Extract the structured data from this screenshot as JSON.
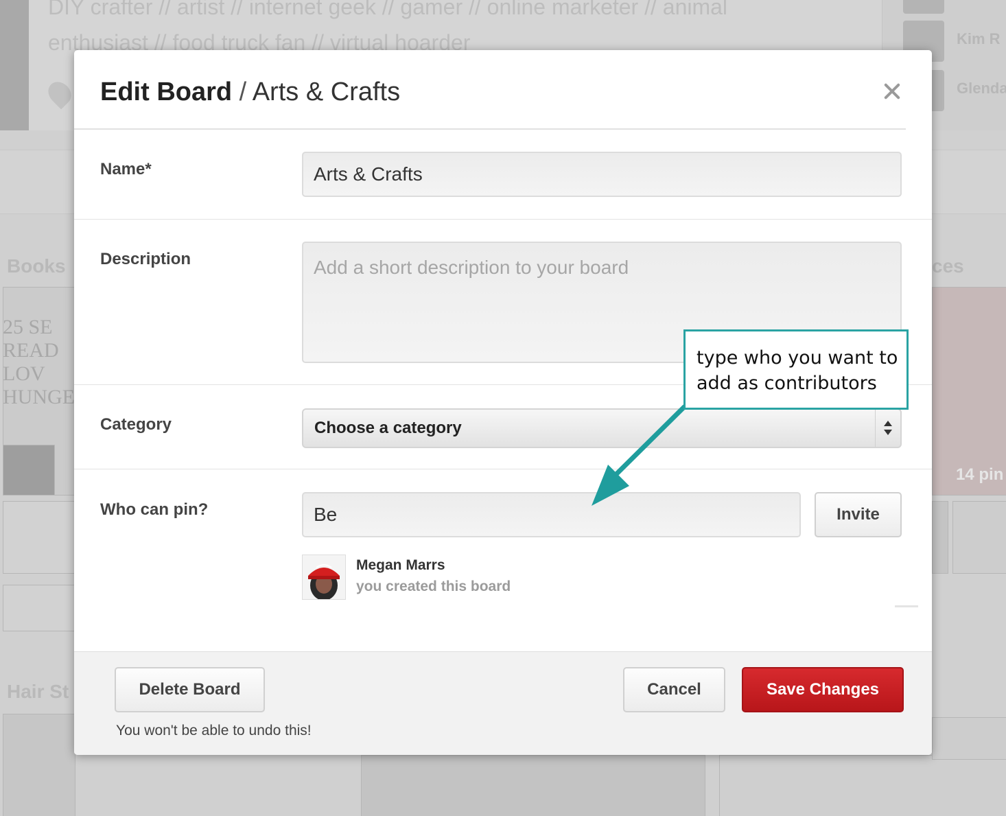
{
  "background": {
    "bio_line1": "DIY crafter // artist // internet geek // gamer // online marketer // animal",
    "bio_line2": "enthusiast // food truck fan // virtual hoarder",
    "sidebar_names": [
      "Kim R",
      "Glenda"
    ],
    "board_titles": [
      "Books",
      "ces",
      "Hair St"
    ],
    "book_cover_text": "25 SE READ LOV HUNGE",
    "pins_count": "14 pin"
  },
  "modal": {
    "title_action": "Edit Board",
    "title_separator": " / ",
    "title_board": "Arts & Crafts",
    "close_icon": "close-icon",
    "name": {
      "label": "Name*",
      "value": "Arts & Crafts"
    },
    "description": {
      "label": "Description",
      "placeholder": "Add a short description to your board",
      "value": ""
    },
    "category": {
      "label": "Category",
      "selected": "Choose a category"
    },
    "who_can_pin": {
      "label": "Who can pin?",
      "value": "Be",
      "invite_label": "Invite",
      "contributors": [
        {
          "name": "Megan Marrs",
          "note": "you created this board"
        }
      ]
    },
    "footer": {
      "delete_label": "Delete Board",
      "delete_warning": "You won't be able to undo this!",
      "cancel_label": "Cancel",
      "save_label": "Save Changes"
    }
  },
  "callout": {
    "text": "type who you want to add as contributors",
    "color": "#2aa3a3"
  },
  "colors": {
    "primary_button": "#c41e22",
    "overlay": "#c9c9c9"
  }
}
